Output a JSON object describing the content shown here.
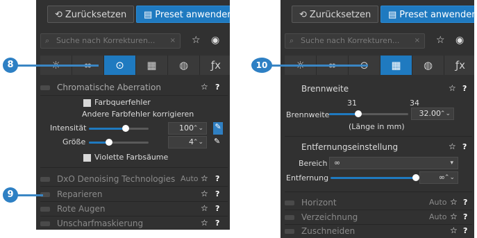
{
  "left": {
    "reset_label": "Zurücksetzen",
    "apply_label": "Preset anwenden",
    "search_placeholder": "Suche nach Korrekturen...",
    "section_chroma": "Chromatische Aberration",
    "farbquerfehler": "Farbquerfehler",
    "andere": "Andere Farbfehler korrigieren",
    "intensitaet_label": "Intensität",
    "intensitaet_value": "100",
    "groesse_label": "Größe",
    "groesse_value": "4",
    "violette": "Violette Farbsäume",
    "denoise_label": "DxO Denoising Technologies",
    "denoise_mode": "Auto",
    "reparieren": "Reparieren",
    "rote_augen": "Rote Augen",
    "unscharf": "Unscharfmaskierung"
  },
  "right": {
    "reset_label": "Zurücksetzen",
    "apply_label": "Preset anwenden",
    "search_placeholder": "Suche nach Korrekturen...",
    "brennweite_header": "Brennweite",
    "tick_min": "31",
    "tick_max": "34",
    "brennweite_label": "Brennweite",
    "brennweite_value": "32.00",
    "laenge": "(Länge in mm)",
    "entfernung_header": "Entfernungseinstellung",
    "bereich_label": "Bereich",
    "bereich_value": "∞",
    "entfernung_label": "Entfernung",
    "entfernung_value": "∞",
    "horizont": "Horizont",
    "horizont_mode": "Auto",
    "verzeichnung": "Verzeichnung",
    "verzeichnung_mode": "Auto",
    "zuschneiden": "Zuschneiden"
  },
  "callouts": {
    "c8": "8",
    "c9": "9",
    "c10": "10"
  },
  "colors": {
    "accent": "#1f7ac0",
    "panel_bg": "#313131",
    "callout": "#2e80c4"
  },
  "icons": [
    "history-icon",
    "preset-icon",
    "search-icon",
    "star-icon",
    "toggle-icon",
    "light-icon",
    "color-icon",
    "detail-icon",
    "geometry-icon",
    "watermark-icon",
    "fx-icon"
  ]
}
